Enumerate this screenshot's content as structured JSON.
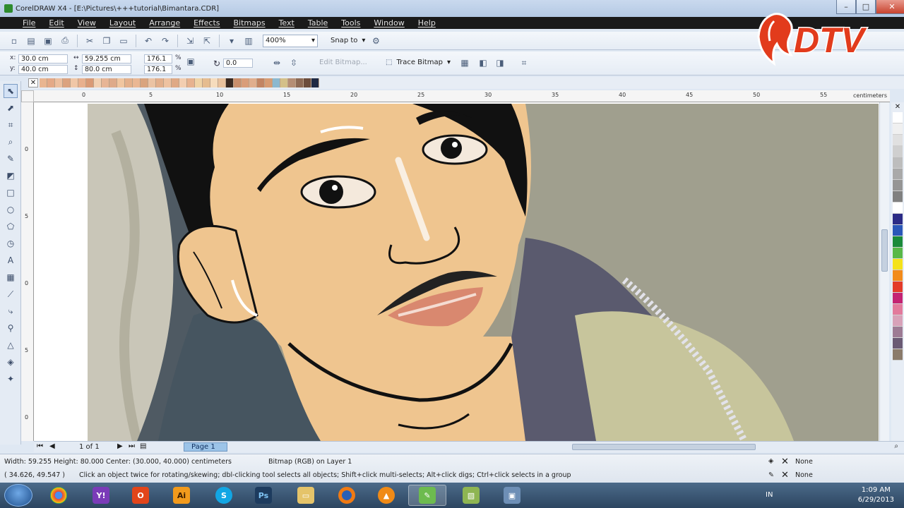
{
  "window": {
    "title": "CorelDRAW X4 - [E:\\Pictures\\+++tutorial\\Bimantara.CDR]"
  },
  "menu": [
    "File",
    "Edit",
    "View",
    "Layout",
    "Arrange",
    "Effects",
    "Bitmaps",
    "Text",
    "Table",
    "Tools",
    "Window",
    "Help"
  ],
  "toolbar": {
    "zoom": "400%",
    "snap_label": "Snap to"
  },
  "propbar": {
    "x_label": "x:",
    "x": "30.0 cm",
    "y_label": "y:",
    "y": "40.0 cm",
    "w": "59.255 cm",
    "h": "80.0 cm",
    "scale_x": "176.1",
    "scale_y": "176.1",
    "percent": "%",
    "angle": "0.0",
    "edit_bitmap": "Edit Bitmap...",
    "trace_bitmap": "Trace Bitmap"
  },
  "ruler": {
    "unit": "centimeters",
    "h_ticks": [
      "0",
      "5",
      "10",
      "15",
      "20",
      "25",
      "30",
      "35",
      "40",
      "45",
      "50",
      "55"
    ],
    "v_ticks": [
      "0",
      "5",
      "0",
      "5",
      "0"
    ]
  },
  "palette_top": [
    "#e9b591",
    "#e4a987",
    "#edbf9f",
    "#dba27f",
    "#f0c7a7",
    "#e8b08e",
    "#d99a76",
    "#f2d0b2",
    "#e7b596",
    "#deaa8a",
    "#f1c6a0",
    "#e4b08b",
    "#eab794",
    "#d9a47f",
    "#ebc3a4",
    "#e2af8c",
    "#eec2a1",
    "#dfa985",
    "#f3ceb1",
    "#e7b28f",
    "#f0d3a6",
    "#e5bc90",
    "#f6dcbd",
    "#e9c29e",
    "#3b2a22",
    "#c98e6c",
    "#d99d7a",
    "#e0ae8e",
    "#c28463",
    "#d79b73",
    "#8cb8cf",
    "#d4c089",
    "#b58e75",
    "#8d6a55",
    "#6c4d3c",
    "#1f2a44"
  ],
  "palette_right": [
    "#ffffff",
    "#f0f0f0",
    "#e0e0e0",
    "#cfcfcf",
    "#bdbdbd",
    "#a9a9a9",
    "#959595",
    "#808080",
    "#ffffff",
    "#2b2b86",
    "#2a57b8",
    "#1a8a3a",
    "#58b848",
    "#f4e21a",
    "#f28b1b",
    "#e33b2a",
    "#c42373",
    "#e27a9c",
    "#d8a2b9",
    "#9d7b94",
    "#6a5a74",
    "#8a7b6b"
  ],
  "pagebar": {
    "page_of": "1 of 1",
    "page_tab": "Page 1"
  },
  "status": {
    "dims": "Width: 59.255  Height: 80.000  Center: (30.000, 40.000)  centimeters",
    "layer": "Bitmap (RGB) on Layer 1",
    "coords": "( 34.626, 49.547 )",
    "hint": "Click an object twice for rotating/skewing; dbl-clicking tool selects all objects; Shift+click multi-selects; Alt+click digs; Ctrl+click selects in a group",
    "fill": "None",
    "outline": "None"
  },
  "taskbar": {
    "apps": [
      "Chrome",
      "Yahoo",
      "Office",
      "Ai",
      "Skype",
      "Ps",
      "Explorer",
      "Firefox",
      "VLC",
      "CorelDRAW",
      "Photos",
      "Remote"
    ],
    "lang": "IN",
    "time": "1:09 AM",
    "date": "6/29/2013"
  },
  "logo": {
    "text": "DTV"
  },
  "colors": {
    "skin": "#efc58f",
    "hair": "#111111",
    "accent": "#e23b1c"
  }
}
